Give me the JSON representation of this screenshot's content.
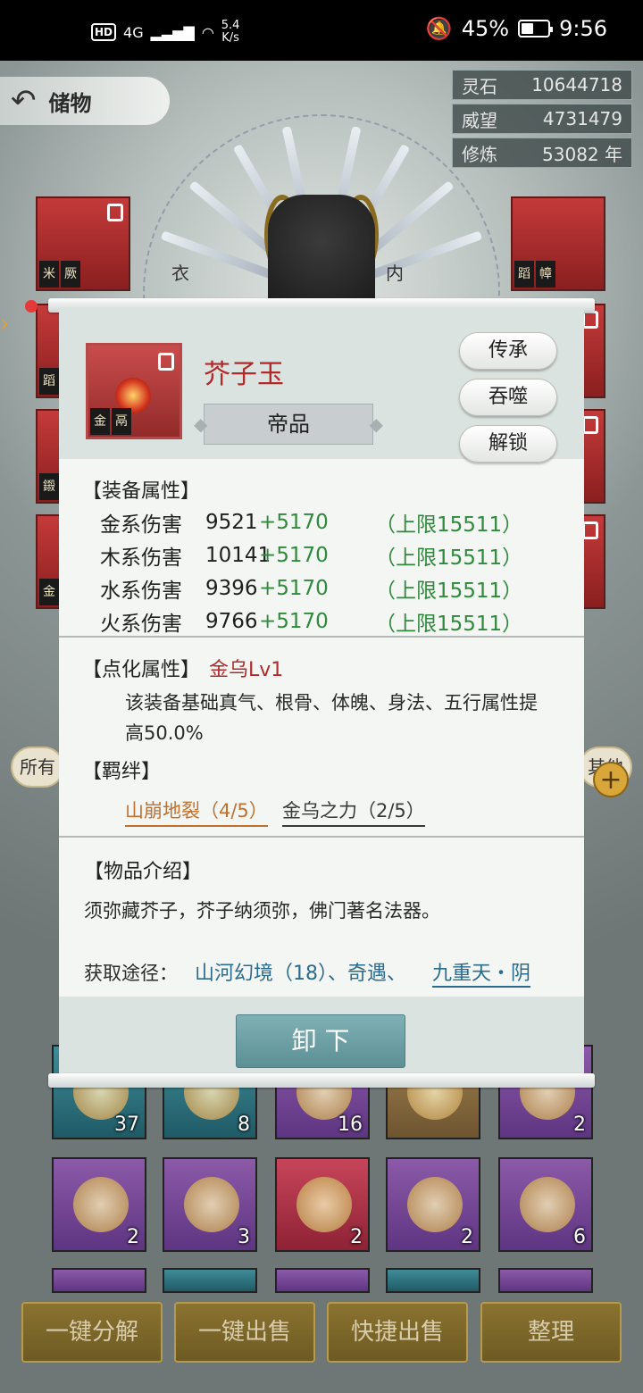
{
  "status_bar": {
    "hd": "HD",
    "signal": "4G",
    "net_speed": "5.4",
    "net_unit": "K/s",
    "battery": "45%",
    "battery_level": 0.45,
    "time": "9:56"
  },
  "header": {
    "title": "储物"
  },
  "resources": [
    {
      "label": "灵石",
      "value": "10644718"
    },
    {
      "label": "威望",
      "value": "4731479"
    },
    {
      "label": "修炼",
      "value": "53082 年"
    }
  ],
  "equip_slots": {
    "left": [
      {
        "tag": "米",
        "tag2": "厥"
      },
      {
        "tag": "蹈"
      },
      {
        "tag": "鎩"
      },
      {
        "tag": "金"
      }
    ],
    "right": [
      {
        "tag": "蹈",
        "tag2": "幛"
      }
    ],
    "hero_labels": [
      "衣",
      "内"
    ]
  },
  "filter_tabs": {
    "left": "所有",
    "right": "其他"
  },
  "inventory_counts": [
    "37",
    "8",
    "16",
    "",
    "2",
    "2",
    "3",
    "2",
    "2",
    "6"
  ],
  "popup": {
    "item_name": "芥子玉",
    "grade": "帝品",
    "icon_tags": [
      "金",
      "鬲"
    ],
    "actions": [
      "传承",
      "吞噬",
      "解锁"
    ],
    "equip_attr_title": "【装备属性】",
    "attributes": [
      {
        "name": "金系伤害",
        "value": "9521",
        "bonus": "+5170",
        "cap": "（上限15511）"
      },
      {
        "name": "木系伤害",
        "value": "10141",
        "bonus": "+5170",
        "cap": "（上限15511）"
      },
      {
        "name": "水系伤害",
        "value": "9396",
        "bonus": "+5170",
        "cap": "（上限15511）"
      },
      {
        "name": "火系伤害",
        "value": "9766",
        "bonus": "+5170",
        "cap": "（上限15511）"
      }
    ],
    "enhance_title": "【点化属性】",
    "enhance_name": "金乌Lv1",
    "enhance_desc": "该装备基础真气、根骨、体魄、身法、五行属性提高50.0%",
    "bond_title": "【羁绊】",
    "bonds": [
      "山崩地裂（4/5）",
      "金乌之力（2/5）"
    ],
    "intro_title": "【物品介绍】",
    "intro_text": "须弥藏芥子，芥子纳须弥，佛门著名法器。",
    "source_label": "获取途径：",
    "source_main": "山河幻境（18）、奇遇、",
    "source_link": "九重天・阴",
    "unequip_label": "卸 下"
  },
  "bottom_buttons": [
    "一键分解",
    "一键出售",
    "快捷出售",
    "整理"
  ]
}
